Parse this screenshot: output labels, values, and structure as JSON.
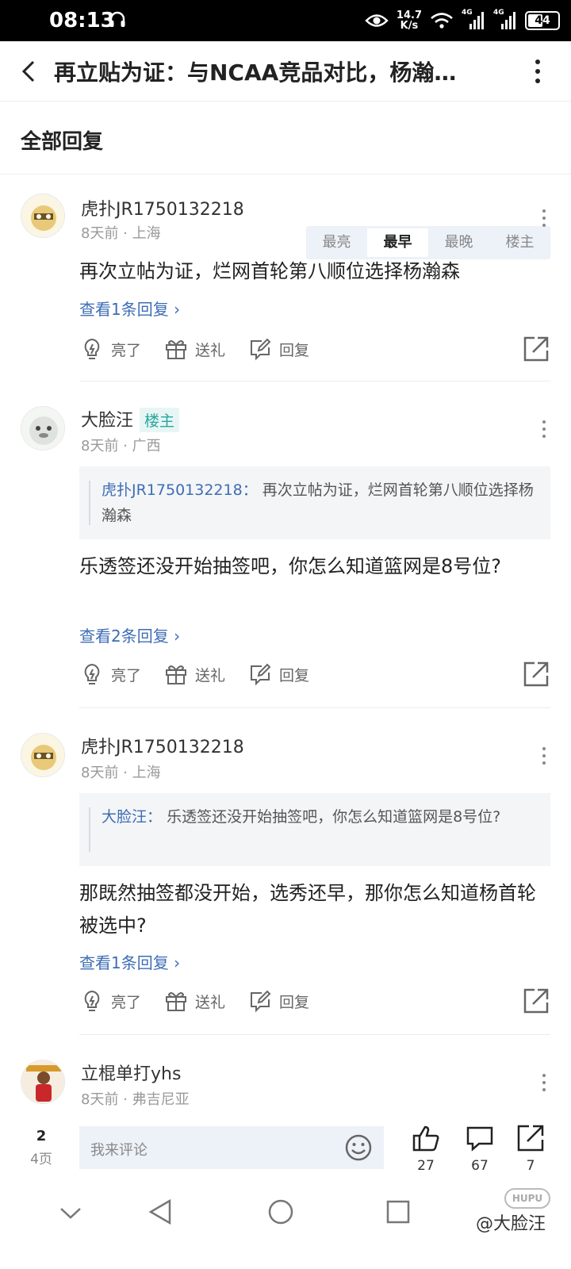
{
  "status_bar": {
    "time": "08:13",
    "net_speed_value": "14.7",
    "net_speed_unit": "K/s",
    "signal_1": "4G",
    "signal_2": "4G",
    "battery": "44"
  },
  "title_bar": {
    "title": "再立贴为证：与NCAA竞品对比，杨瀚…"
  },
  "sort_header": {
    "label": "全部回复",
    "tabs": [
      "最亮",
      "最早",
      "最晚",
      "楼主"
    ],
    "active_tab": "最早"
  },
  "action_labels": {
    "light": "亮了",
    "gift": "送礼",
    "reply": "回复"
  },
  "comments": [
    {
      "username": "虎扑JR1750132218",
      "badge": "",
      "time": "8天前",
      "location": "上海",
      "quote_name": "",
      "quote_text": "",
      "text": "再次立帖为证，烂网首轮第八顺位选择杨瀚森",
      "view_replies": "查看1条回复"
    },
    {
      "username": "大脸汪",
      "badge": "楼主",
      "time": "8天前",
      "location": "广西",
      "quote_name": "虎扑JR1750132218",
      "quote_text": "再次立帖为证，烂网首轮第八顺位选择杨瀚森",
      "text": "乐透签还没开始抽签吧，你怎么知道篮网是8号位?",
      "view_replies": "查看2条回复"
    },
    {
      "username": "虎扑JR1750132218",
      "badge": "",
      "time": "8天前",
      "location": "上海",
      "quote_name": "大脸汪",
      "quote_text": "乐透签还没开始抽签吧，你怎么知道篮网是8号位?",
      "text": "那既然抽签都没开始，选秀还早，那你怎么知道杨首轮被选中?",
      "view_replies": "查看1条回复"
    },
    {
      "username": "立棍单打yhs",
      "badge": "",
      "time": "8天前",
      "location": "弗吉尼亚",
      "quote_name": "",
      "quote_text": "",
      "text": "",
      "view_replies": ""
    }
  ],
  "bottom_bar": {
    "current_page": "2",
    "total_pages": "4页",
    "input_placeholder": "我来评论",
    "likes": "27",
    "comments": "67",
    "shares": "7"
  },
  "watermark": {
    "logo_text": "HUPU",
    "text": "@大脸汪"
  },
  "colors": {
    "link_blue": "#3e6db5",
    "badge_teal": "#27a79e",
    "tab_bg": "#edf1f8"
  }
}
